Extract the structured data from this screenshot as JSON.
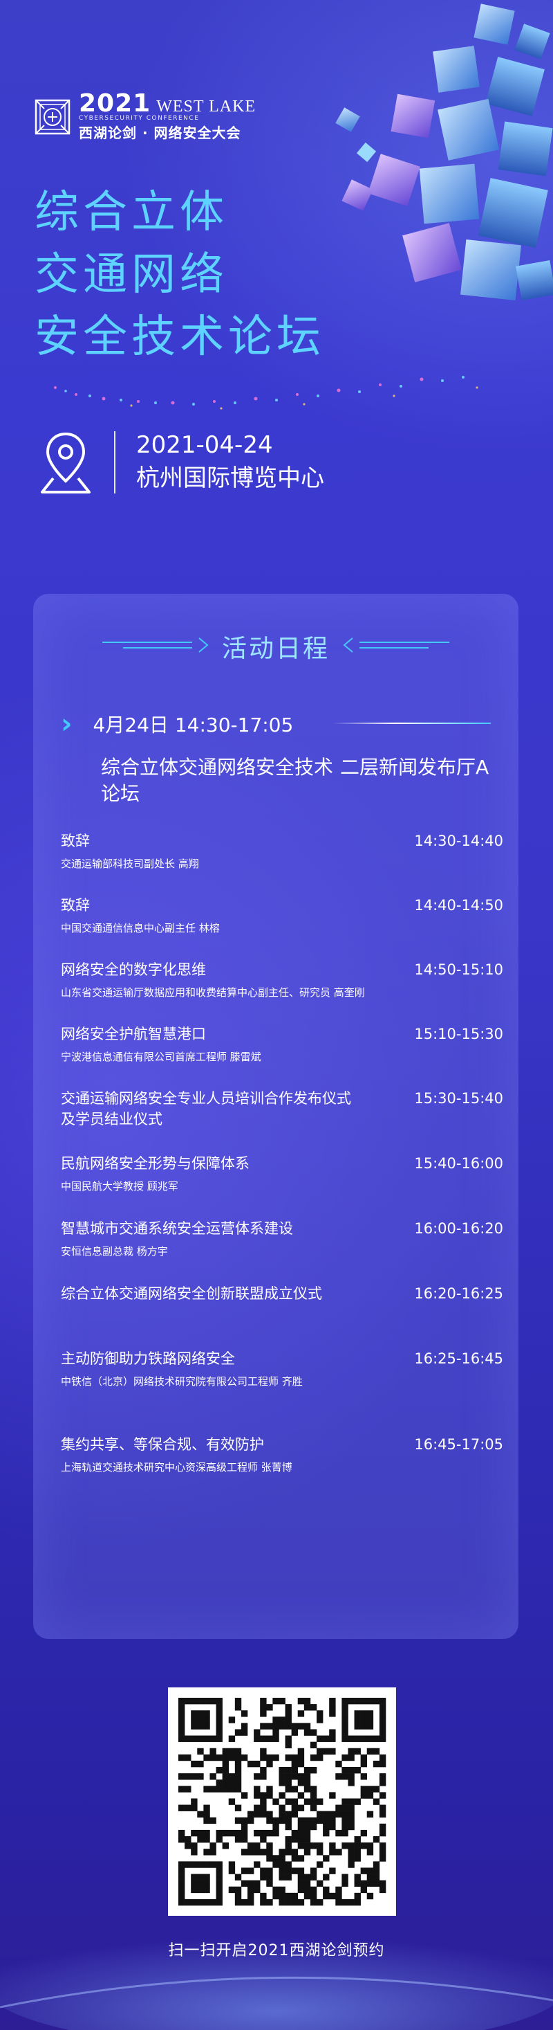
{
  "header": {
    "year": "2021",
    "brand_en": "WEST LAKE",
    "brand_sub_en": "CYBERSECURITY CONFERENCE",
    "brand_cn": "西湖论剑 · 网络安全大会",
    "title_lines": [
      "综合立体",
      "交通网络",
      "安全技术论坛"
    ],
    "colors": {
      "title": "#5fd3ff",
      "accent": "#46c8ff"
    }
  },
  "event": {
    "icon": "location-pin-icon",
    "date": "2021-04-24",
    "venue": "杭州国际博览中心"
  },
  "schedule": {
    "heading": "活动日程",
    "session": {
      "time": "4月24日  14:30-17:05",
      "name": "综合立体交通网络安全技术论坛",
      "room": "二层新闻发布厅A"
    },
    "items": [
      {
        "title": "致辞",
        "sub": "交通运输部科技司副处长  高翔",
        "time": "14:30-14:40"
      },
      {
        "title": "致辞",
        "sub": "中国交通通信信息中心副主任  林榕",
        "time": "14:40-14:50"
      },
      {
        "title": "网络安全的数字化思维",
        "sub": "山东省交通运输厅数据应用和收费结算中心副主任、研究员  高奎刚",
        "time": "14:50-15:10"
      },
      {
        "title": "网络安全护航智慧港口",
        "sub": "宁波港信息通信有限公司首席工程师  滕雷斌",
        "time": "15:10-15:30"
      },
      {
        "title": "交通运输网络安全专业人员培训合作发布仪式及学员结业仪式",
        "sub": "",
        "time": "15:30-15:40"
      },
      {
        "title": "民航网络安全形势与保障体系",
        "sub": "中国民航大学教授  顾兆军",
        "time": "15:40-16:00"
      },
      {
        "title": "智慧城市交通系统安全运营体系建设",
        "sub": "安恒信息副总裁  杨方宇",
        "time": "16:00-16:20"
      },
      {
        "title": "综合立体交通网络安全创新联盟成立仪式",
        "sub": "",
        "time": "16:20-16:25"
      },
      {
        "title": "主动防御助力铁路网络安全",
        "sub": "中铁信（北京）网络技术研究院有限公司工程师  齐胜",
        "time": "16:25-16:45"
      },
      {
        "title": "集约共享、等保合规、有效防护",
        "sub": "上海轨道交通技术研究中心资深高级工程师  张菁博",
        "time": "16:45-17:05"
      }
    ]
  },
  "footer": {
    "qr_icon": "qr-code-icon",
    "caption": "扫一扫开启2021西湖论剑预约"
  }
}
